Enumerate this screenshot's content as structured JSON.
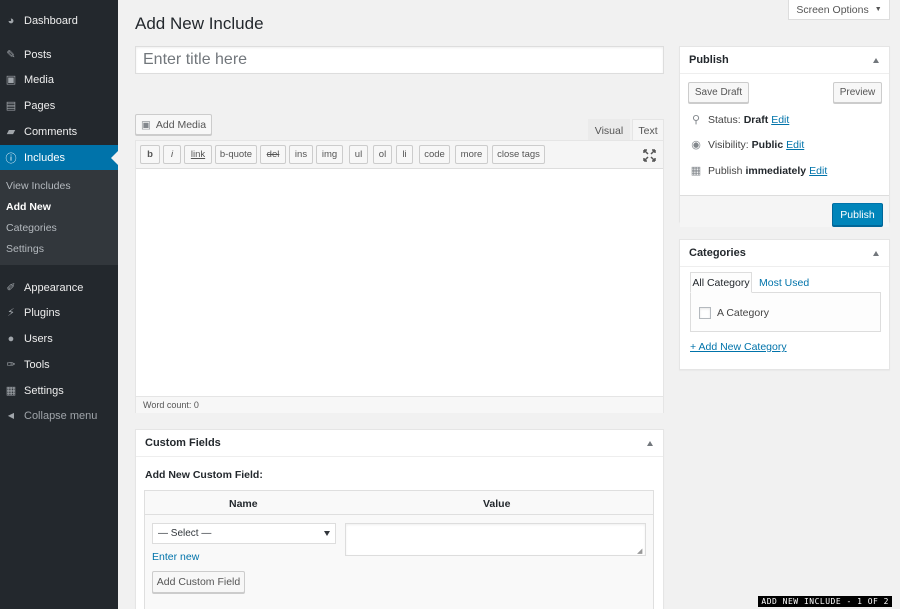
{
  "sidebar": {
    "items": [
      {
        "label": "Dashboard",
        "icon": "dashboard-icon",
        "glyph": "◕"
      },
      {
        "label": "Posts",
        "icon": "pin-icon",
        "glyph": "✎"
      },
      {
        "label": "Media",
        "icon": "media-icon",
        "glyph": "▣"
      },
      {
        "label": "Pages",
        "icon": "pages-icon",
        "glyph": "▤"
      },
      {
        "label": "Comments",
        "icon": "comment-icon",
        "glyph": "▰"
      },
      {
        "label": "Includes",
        "icon": "info-icon",
        "glyph": "ⓘ"
      }
    ],
    "submenu": [
      "View Includes",
      "Add New",
      "Categories",
      "Settings"
    ],
    "items2": [
      {
        "label": "Appearance",
        "icon": "brush-icon",
        "glyph": "✐"
      },
      {
        "label": "Plugins",
        "icon": "plug-icon",
        "glyph": "⚡"
      },
      {
        "label": "Users",
        "icon": "user-icon",
        "glyph": "●"
      },
      {
        "label": "Tools",
        "icon": "wrench-icon",
        "glyph": "✑"
      },
      {
        "label": "Settings",
        "icon": "settings-icon",
        "glyph": "▦"
      }
    ],
    "collapse": {
      "label": "Collapse menu",
      "icon": "collapse-arrow-icon",
      "glyph": "◀"
    }
  },
  "header": {
    "title": "Add New Include",
    "screen_options": "Screen Options"
  },
  "editor": {
    "title_placeholder": "Enter title here",
    "add_media": "Add Media",
    "tab_visual": "Visual",
    "tab_text": "Text",
    "quicktags": [
      "b",
      "i",
      "link",
      "b-quote",
      "del",
      "ins",
      "img",
      "ul",
      "ol",
      "li",
      "code",
      "more",
      "close tags"
    ],
    "word_count": "Word count: 0"
  },
  "publish": {
    "heading": "Publish",
    "save_draft": "Save Draft",
    "preview": "Preview",
    "status_label": "Status:",
    "status_value": "Draft",
    "visibility_label": "Visibility:",
    "visibility_value": "Public",
    "publish_label": "Publish",
    "publish_value": "immediately",
    "edit": "Edit",
    "publish_button": "Publish"
  },
  "categories": {
    "heading": "Categories",
    "tab_all": "All Category",
    "tab_most": "Most Used",
    "items": [
      "A Category"
    ],
    "add_new": "+ Add New Category"
  },
  "custom_fields": {
    "heading": "Custom Fields",
    "subheading": "Add New Custom Field:",
    "col_name": "Name",
    "col_value": "Value",
    "select_value": "— Select —",
    "enter_new": "Enter new",
    "add_button": "Add Custom Field"
  },
  "footer": {
    "label": "ADD NEW INCLUDE - 1 OF 2"
  },
  "colors": {
    "sidebar_bg": "#23282d",
    "active": "#0073aa",
    "primary_button": "#0085ba",
    "link": "#0073aa"
  }
}
